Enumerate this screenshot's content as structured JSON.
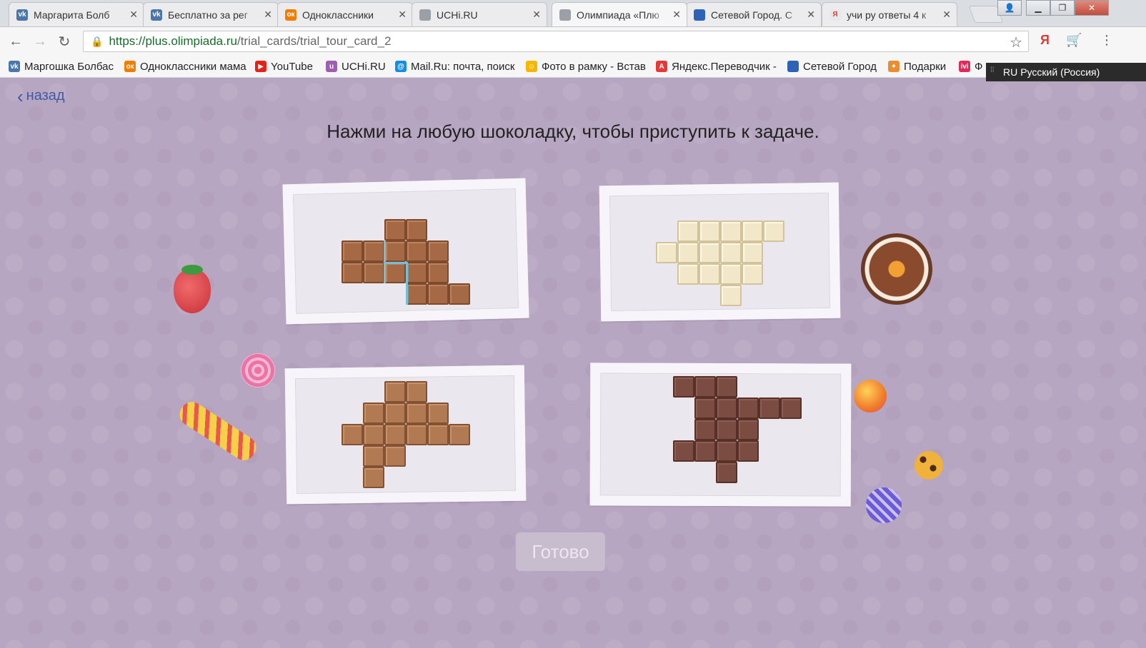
{
  "browser": {
    "tabs": [
      {
        "title": "Маргарита Болб",
        "icon": "vk-icon",
        "color": "#4a76a8",
        "glyph": "vk"
      },
      {
        "title": "Бесплатно за рег",
        "icon": "vk-icon",
        "color": "#4a76a8",
        "glyph": "vk"
      },
      {
        "title": "Одноклассники",
        "icon": "odnoklassniki-icon",
        "color": "#f07d00",
        "glyph": "ок"
      },
      {
        "title": "UCHi.RU",
        "icon": "page-icon",
        "color": "#9aa0a6",
        "glyph": ""
      },
      {
        "title": "Олимпиада «Плю",
        "icon": "page-icon",
        "color": "#9aa0a6",
        "glyph": ""
      },
      {
        "title": "Сетевой Город. С",
        "icon": "setevoy-gorod-icon",
        "color": "#2e62b8",
        "glyph": ""
      },
      {
        "title": "учи ру ответы 4 к",
        "icon": "yandex-icon",
        "color": "#e8e8e8",
        "glyph": "Я"
      }
    ],
    "url_host": "https://plus.olimpiada.ru",
    "url_path": "/trial_cards/trial_tour_card_2",
    "bookmarks": [
      {
        "label": "Маргошка Болбас",
        "icon": "vk-icon",
        "color": "#4a76a8",
        "glyph": "vk"
      },
      {
        "label": "Одноклассники мама",
        "icon": "odnoklassniki-icon",
        "color": "#f07d00",
        "glyph": "ок"
      },
      {
        "label": "YouTube",
        "icon": "youtube-icon",
        "color": "#e62117",
        "glyph": "▶"
      },
      {
        "label": "UCHi.RU",
        "icon": "uchi-icon",
        "color": "#9f5fb0",
        "glyph": "u"
      },
      {
        "label": "Mail.Ru: почта, поиск",
        "icon": "mailru-icon",
        "color": "#168de2",
        "glyph": "@"
      },
      {
        "label": "Фото в рамку - Встав",
        "icon": "smiley-icon",
        "color": "#f5b800",
        "glyph": "☺"
      },
      {
        "label": "Яндекс.Переводчик -",
        "icon": "translate-icon",
        "color": "#e53935",
        "glyph": "A"
      },
      {
        "label": "Сетевой Город",
        "icon": "setevoy-gorod-icon",
        "color": "#2e62b8",
        "glyph": ""
      },
      {
        "label": "Подарки",
        "icon": "gift-icon",
        "color": "#e88e2e",
        "glyph": "✦"
      },
      {
        "label": "Ф",
        "icon": "ivi-icon",
        "color": "#e4275a",
        "glyph": "ivi"
      }
    ],
    "language": {
      "code": "RU",
      "name": "Русский (Россия)"
    }
  },
  "page": {
    "back_label": "назад",
    "instruction": "Нажми на любую шоколадку, чтобы приступить к задаче.",
    "done_label": "Готово"
  }
}
